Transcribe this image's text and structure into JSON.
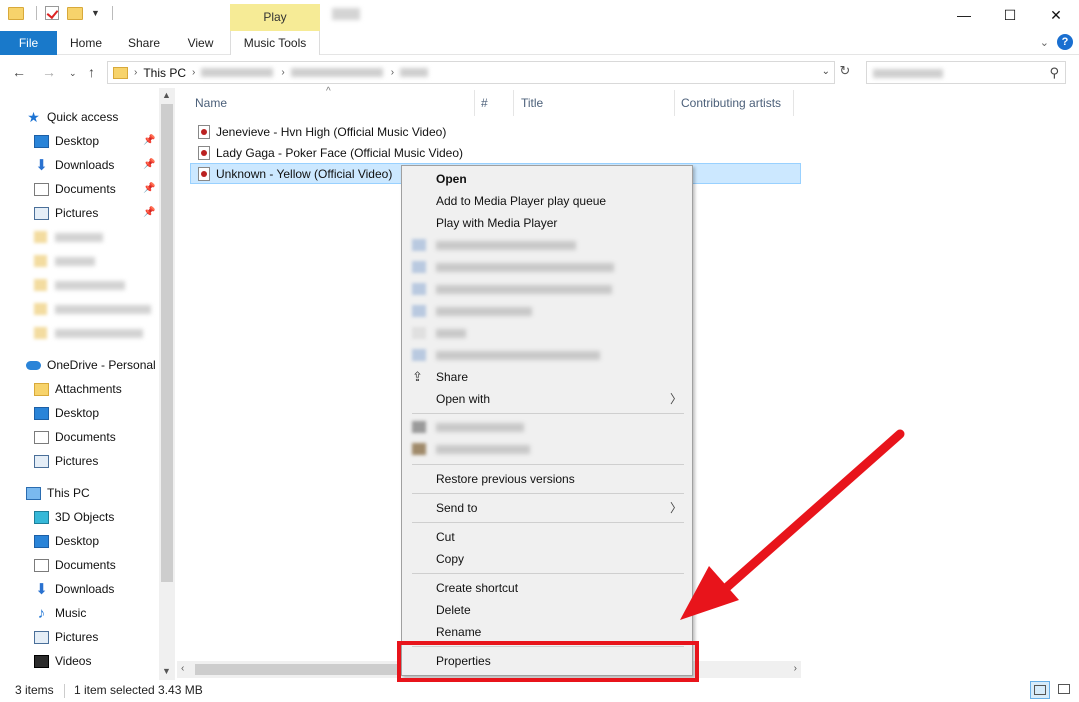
{
  "ribbon": {
    "tabs": [
      "File",
      "Home",
      "Share",
      "View",
      "Music Tools"
    ],
    "contextual_header": "Play"
  },
  "address": {
    "crumb_this_pc": "This PC"
  },
  "columns": {
    "name": "Name",
    "number": "#",
    "title": "Title",
    "contributing_artists": "Contributing artists"
  },
  "files": [
    "Jenevieve - Hvn High (Official Music Video)",
    "Lady Gaga - Poker Face (Official Music Video)",
    "Unknown - Yellow (Official Video)"
  ],
  "nav": {
    "quick_access": "Quick access",
    "qa_items": [
      "Desktop",
      "Downloads",
      "Documents",
      "Pictures"
    ],
    "onedrive": "OneDrive - Personal",
    "od_items": [
      "Attachments",
      "Desktop",
      "Documents",
      "Pictures"
    ],
    "this_pc": "This PC",
    "pc_items": [
      "3D Objects",
      "Desktop",
      "Documents",
      "Downloads",
      "Music",
      "Pictures",
      "Videos"
    ]
  },
  "context_menu": {
    "open": "Open",
    "add_queue": "Add to Media Player play queue",
    "play_with": "Play with Media Player",
    "share": "Share",
    "open_with": "Open with",
    "restore": "Restore previous versions",
    "send_to": "Send to",
    "cut": "Cut",
    "copy": "Copy",
    "create_shortcut": "Create shortcut",
    "delete": "Delete",
    "rename": "Rename",
    "properties": "Properties"
  },
  "status": {
    "items_count": "3 items",
    "selection": "1 item selected  3.43 MB"
  },
  "colors": {
    "file_tab": "#1979ca",
    "contextual_tab": "#f6eb96",
    "selection": "#cce8ff",
    "annotation_red": "#e8141b"
  }
}
